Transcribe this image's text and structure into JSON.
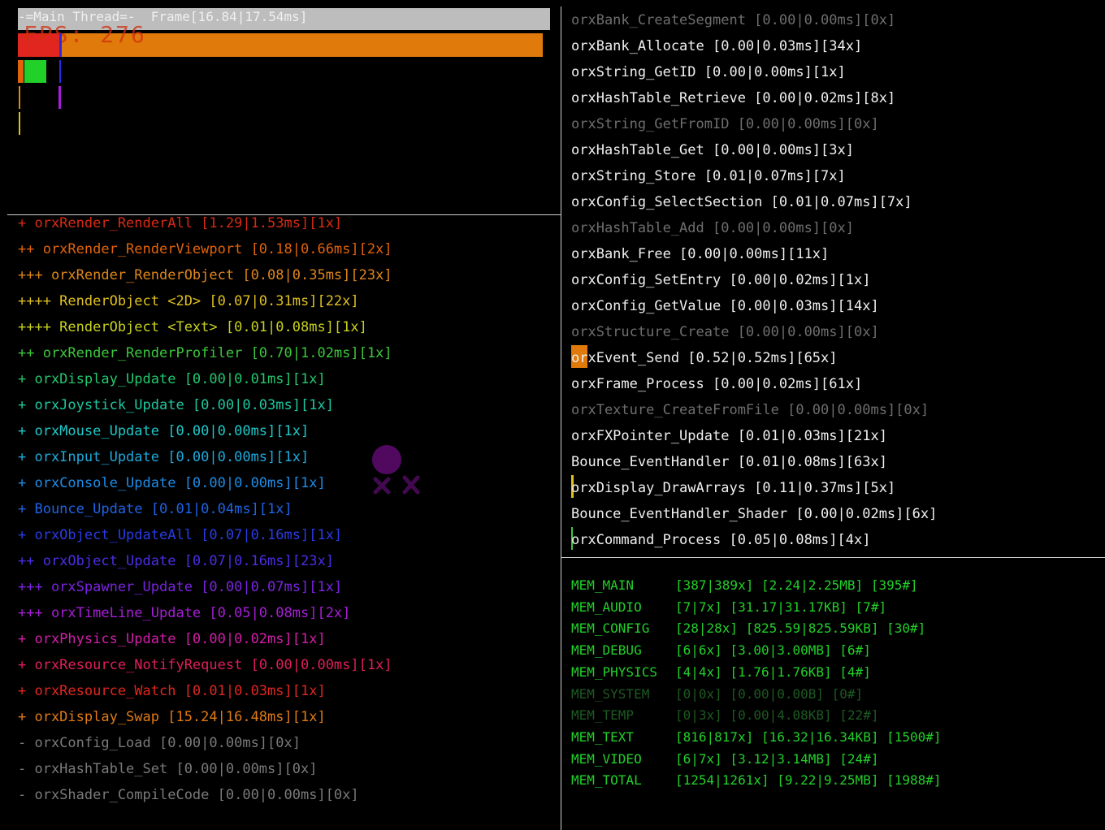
{
  "thread": {
    "label": "-=Main Thread=-  Frame[16.84|17.54ms]",
    "fps_text": "FPS: 276"
  },
  "calls_left": [
    {
      "text": "+ orxRender_RenderAll [1.29|1.53ms][1x]",
      "color": "#d82a14"
    },
    {
      "text": "++ orxRender_RenderViewport [0.18|0.66ms][2x]",
      "color": "#e0630a"
    },
    {
      "text": "+++ orxRender_RenderObject [0.08|0.35ms][23x]",
      "color": "#e0861a"
    },
    {
      "text": "++++ RenderObject <2D> [0.07|0.31ms][22x]",
      "color": "#e0c020"
    },
    {
      "text": "++++ RenderObject <Text> [0.01|0.08ms][1x]",
      "color": "#c8d21e"
    },
    {
      "text": "++ orxRender_RenderProfiler [0.70|1.02ms][1x]",
      "color": "#3cc83c"
    },
    {
      "text": "+ orxDisplay_Update [0.00|0.01ms][1x]",
      "color": "#22c86e"
    },
    {
      "text": "+ orxJoystick_Update [0.00|0.03ms][1x]",
      "color": "#1ec8a0"
    },
    {
      "text": "+ orxMouse_Update [0.00|0.00ms][1x]",
      "color": "#1ec8c8"
    },
    {
      "text": "+ orxInput_Update [0.00|0.00ms][1x]",
      "color": "#1eaadc"
    },
    {
      "text": "+ orxConsole_Update [0.00|0.00ms][1x]",
      "color": "#1e8ce6"
    },
    {
      "text": "+ Bounce_Update [0.01|0.04ms][1x]",
      "color": "#1e64e6"
    },
    {
      "text": "+ orxObject_UpdateAll [0.07|0.16ms][1x]",
      "color": "#2a3ce6"
    },
    {
      "text": "++ orxObject_Update [0.07|0.16ms][23x]",
      "color": "#4a2ee6"
    },
    {
      "text": "+++ orxSpawner_Update [0.00|0.07ms][1x]",
      "color": "#7a24e0"
    },
    {
      "text": "+++ orxTimeLine_Update [0.05|0.08ms][2x]",
      "color": "#a81ed8"
    },
    {
      "text": "+ orxPhysics_Update [0.00|0.02ms][1x]",
      "color": "#d21ea8"
    },
    {
      "text": "+ orxResource_NotifyRequest [0.00|0.00ms][1x]",
      "color": "#e01e5a"
    },
    {
      "text": "+ orxResource_Watch [0.01|0.03ms][1x]",
      "color": "#e0261e"
    },
    {
      "text": "+ orxDisplay_Swap [15.24|16.48ms][1x]",
      "color": "#e07a14"
    },
    {
      "text": "- orxConfig_Load [0.00|0.00ms][0x]",
      "color": "#7a7a7a"
    },
    {
      "text": "- orxHashTable_Set [0.00|0.00ms][0x]",
      "color": "#7a7a7a"
    },
    {
      "text": "- orxShader_CompileCode [0.00|0.00ms][0x]",
      "color": "#7a7a7a"
    }
  ],
  "calls_right": [
    {
      "text": "orxBank_CreateSegment [0.00|0.00ms][0x]",
      "color": "#6e6e6e"
    },
    {
      "text": "orxBank_Allocate [0.00|0.03ms][34x]",
      "color": "#f0f0f0"
    },
    {
      "text": "orxString_GetID [0.00|0.00ms][1x]",
      "color": "#f0f0f0"
    },
    {
      "text": "orxHashTable_Retrieve [0.00|0.02ms][8x]",
      "color": "#f0f0f0"
    },
    {
      "text": "orxString_GetFromID [0.00|0.00ms][0x]",
      "color": "#6e6e6e"
    },
    {
      "text": "orxHashTable_Get [0.00|0.00ms][3x]",
      "color": "#f0f0f0"
    },
    {
      "text": "orxString_Store [0.01|0.07ms][7x]",
      "color": "#f0f0f0"
    },
    {
      "text": "orxConfig_SelectSection [0.01|0.07ms][7x]",
      "color": "#f0f0f0"
    },
    {
      "text": "orxHashTable_Add [0.00|0.00ms][0x]",
      "color": "#6e6e6e"
    },
    {
      "text": "orxBank_Free [0.00|0.00ms][11x]",
      "color": "#f0f0f0"
    },
    {
      "text": "orxConfig_SetEntry [0.00|0.02ms][1x]",
      "color": "#f0f0f0"
    },
    {
      "text": "orxConfig_GetValue [0.00|0.03ms][14x]",
      "color": "#f0f0f0"
    },
    {
      "text": "orxStructure_Create [0.00|0.00ms][0x]",
      "color": "#6e6e6e"
    },
    {
      "text": "orxEvent_Send [0.52|0.52ms][65x]",
      "color": "#f0f0f0"
    },
    {
      "text": "orxFrame_Process [0.00|0.02ms][61x]",
      "color": "#f0f0f0"
    },
    {
      "text": "orxTexture_CreateFromFile [0.00|0.00ms][0x]",
      "color": "#6e6e6e"
    },
    {
      "text": "orxFXPointer_Update [0.01|0.03ms][21x]",
      "color": "#f0f0f0"
    },
    {
      "text": "Bounce_EventHandler [0.01|0.08ms][63x]",
      "color": "#f0f0f0"
    },
    {
      "text": "orxDisplay_DrawArrays [0.11|0.37ms][5x]",
      "color": "#f0f0f0"
    },
    {
      "text": "Bounce_EventHandler_Shader [0.00|0.02ms][6x]",
      "color": "#f0f0f0"
    },
    {
      "text": "orxCommand_Process [0.05|0.08ms][4x]",
      "color": "#f0f0f0"
    }
  ],
  "memory": [
    {
      "name": "MEM_MAIN",
      "values": "[387|389x] [2.24|2.25MB] [395#]",
      "color": "#22d02a"
    },
    {
      "name": "MEM_AUDIO",
      "values": "[7|7x] [31.17|31.17KB] [7#]",
      "color": "#22d02a"
    },
    {
      "name": "MEM_CONFIG",
      "values": "[28|28x] [825.59|825.59KB] [30#]",
      "color": "#22d02a"
    },
    {
      "name": "MEM_DEBUG",
      "values": "[6|6x] [3.00|3.00MB] [6#]",
      "color": "#22d02a"
    },
    {
      "name": "MEM_PHYSICS",
      "values": "[4|4x] [1.76|1.76KB] [4#]",
      "color": "#22d02a"
    },
    {
      "name": "MEM_SYSTEM",
      "values": "[0|0x] [0.00|0.00B] [0#]",
      "color": "#1e5a22"
    },
    {
      "name": "MEM_TEMP",
      "values": "[0|3x] [0.00|4.08KB] [22#]",
      "color": "#1e5a22"
    },
    {
      "name": "MEM_TEXT",
      "values": "[816|817x] [16.32|16.34KB] [1500#]",
      "color": "#22d02a"
    },
    {
      "name": "MEM_VIDEO",
      "values": "[6|7x] [3.12|3.14MB] [24#]",
      "color": "#22d02a"
    },
    {
      "name": "MEM_TOTAL",
      "values": "[1254|1261x] [9.22|9.25MB] [1988#]",
      "color": "#22d02a"
    }
  ]
}
